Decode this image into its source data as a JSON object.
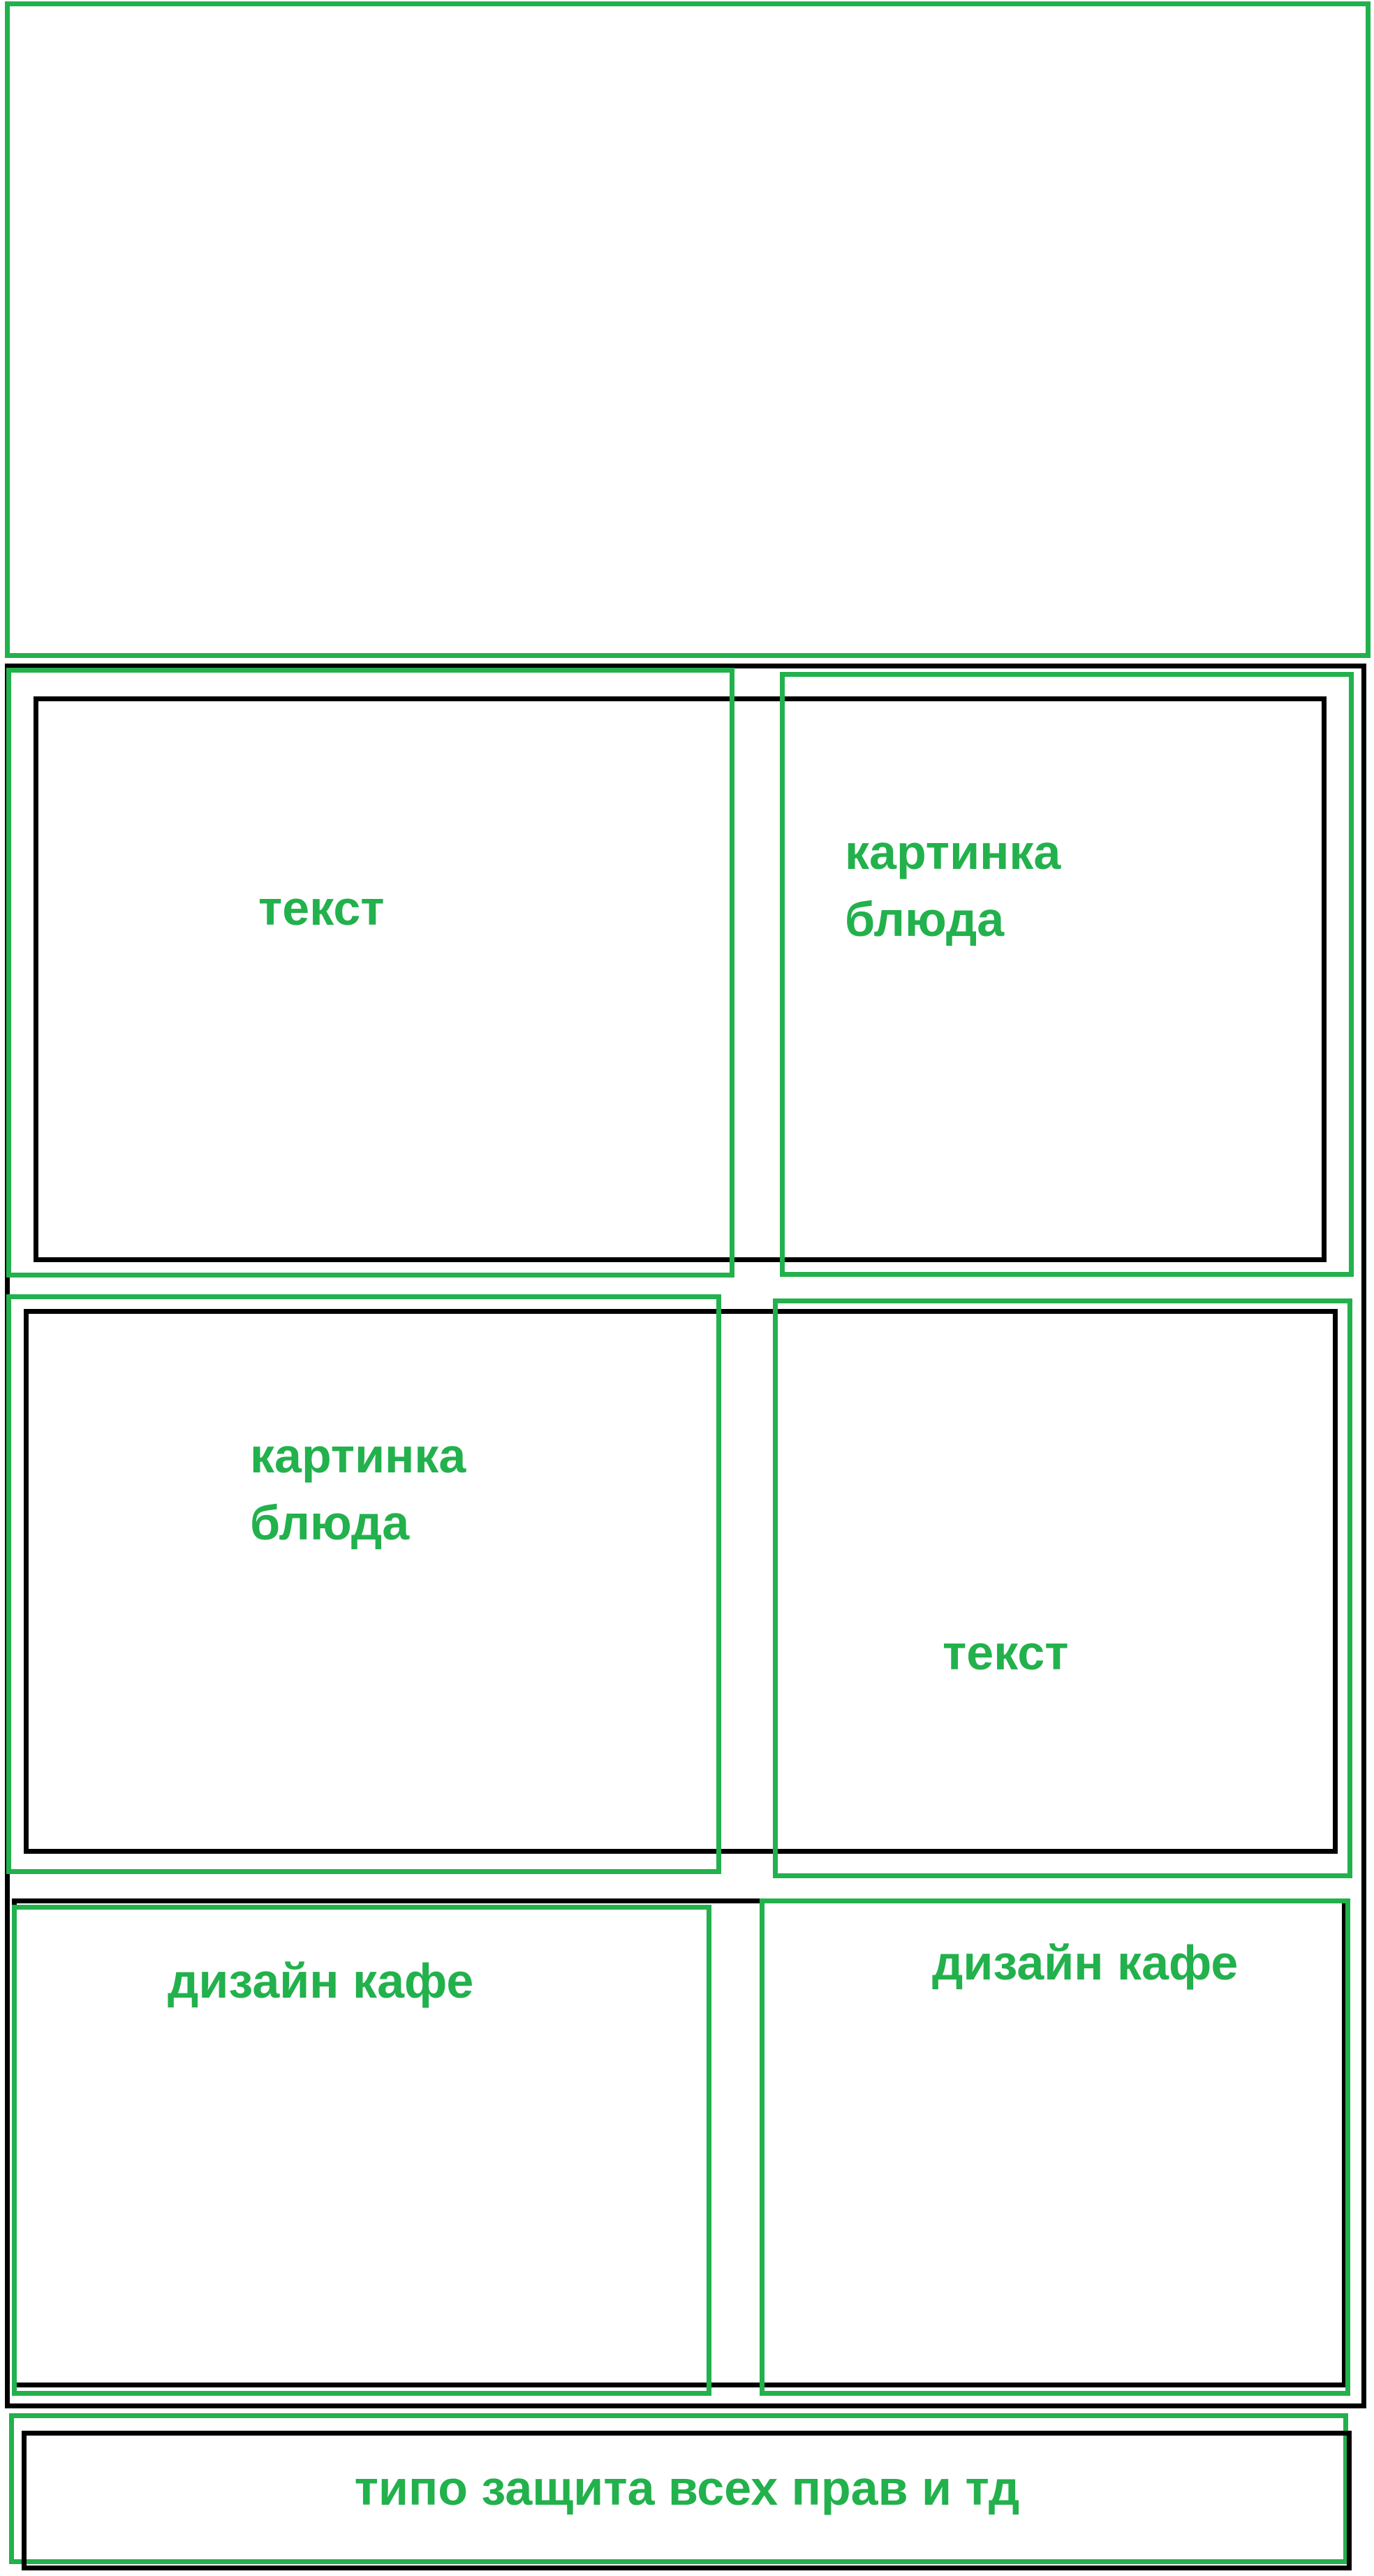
{
  "colors": {
    "green": "#22b14c",
    "black": "#000000",
    "background": "#ffffff"
  },
  "labels": {
    "row1_left": "текст",
    "row1_right": "картинка\nблюда",
    "row2_left": "картинка\nблюда",
    "row2_right": "текст",
    "row3_left": "дизайн кафе",
    "row3_right": "дизайн кафе",
    "footer": "типо защита всех прав и тд"
  }
}
